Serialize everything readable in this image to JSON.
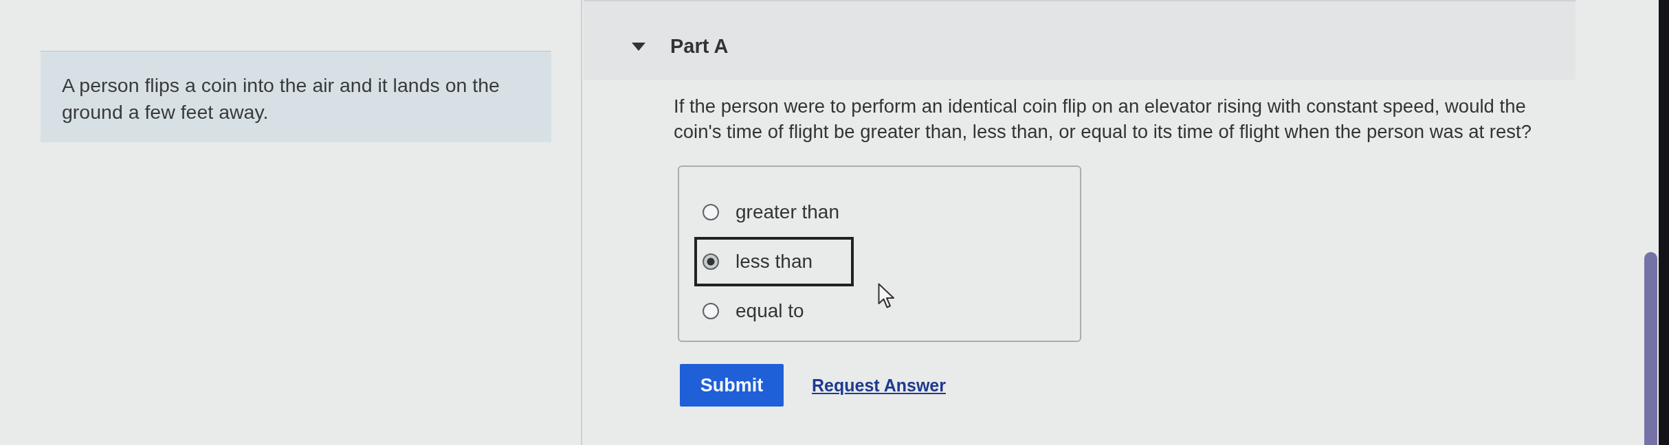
{
  "problem": {
    "text": "A person flips a coin into the air and it lands on the ground a few feet away."
  },
  "part": {
    "title": "Part A",
    "expanded": true
  },
  "question": {
    "text": "If the person were to perform an identical coin flip on an elevator rising with constant speed, would the coin's time of flight be greater than, less than, or equal to its time of flight when the person was at rest?"
  },
  "options": [
    {
      "label": "greater than",
      "selected": false
    },
    {
      "label": "less than",
      "selected": true
    },
    {
      "label": "equal to",
      "selected": false
    }
  ],
  "actions": {
    "submit": "Submit",
    "request": "Request Answer"
  }
}
